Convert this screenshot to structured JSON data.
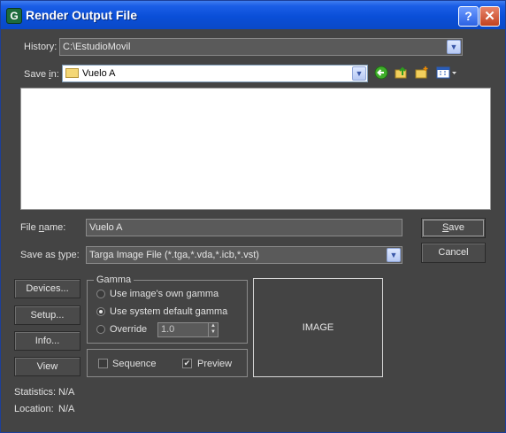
{
  "window": {
    "title": "Render Output File",
    "help_glyph": "?",
    "close_glyph": "✕",
    "app_icon_glyph": "G"
  },
  "history": {
    "label": "History:",
    "value": "C:\\EstudioMovil"
  },
  "save_in": {
    "label_pre": "Save ",
    "label_u": "i",
    "label_post": "n:",
    "value": "Vuelo A",
    "tools": [
      "back-arrow-icon",
      "up-folder-icon",
      "new-folder-icon",
      "view-menu-icon"
    ]
  },
  "file_name": {
    "label_pre": "File ",
    "label_u": "n",
    "label_post": "ame:",
    "value": "Vuelo A"
  },
  "save_as_type": {
    "label_pre": "Save as ",
    "label_u": "t",
    "label_post": "ype:",
    "value": "Targa Image File (*.tga,*.vda,*.icb,*.vst)"
  },
  "buttons": {
    "save_u": "S",
    "save_rest": "ave",
    "cancel": "Cancel"
  },
  "side_buttons": [
    "Devices...",
    "Setup...",
    "Info...",
    "View"
  ],
  "gamma": {
    "legend": "Gamma",
    "options": [
      {
        "label": "Use image's own gamma",
        "selected": false
      },
      {
        "label": "Use system default gamma",
        "selected": true
      },
      {
        "label": "Override",
        "selected": false
      }
    ],
    "override_value": "1.0"
  },
  "sequence": {
    "label": "Sequence",
    "checked": false
  },
  "preview": {
    "label": "Preview",
    "checked": true
  },
  "image_placeholder": "IMAGE",
  "statistics": {
    "label": "Statistics:",
    "value": "N/A"
  },
  "location": {
    "label": "Location:",
    "value": "N/A"
  },
  "colors": {
    "title_bar": "#0a4fd8",
    "panel_bg": "#444444",
    "list_bg": "#ffffff"
  }
}
